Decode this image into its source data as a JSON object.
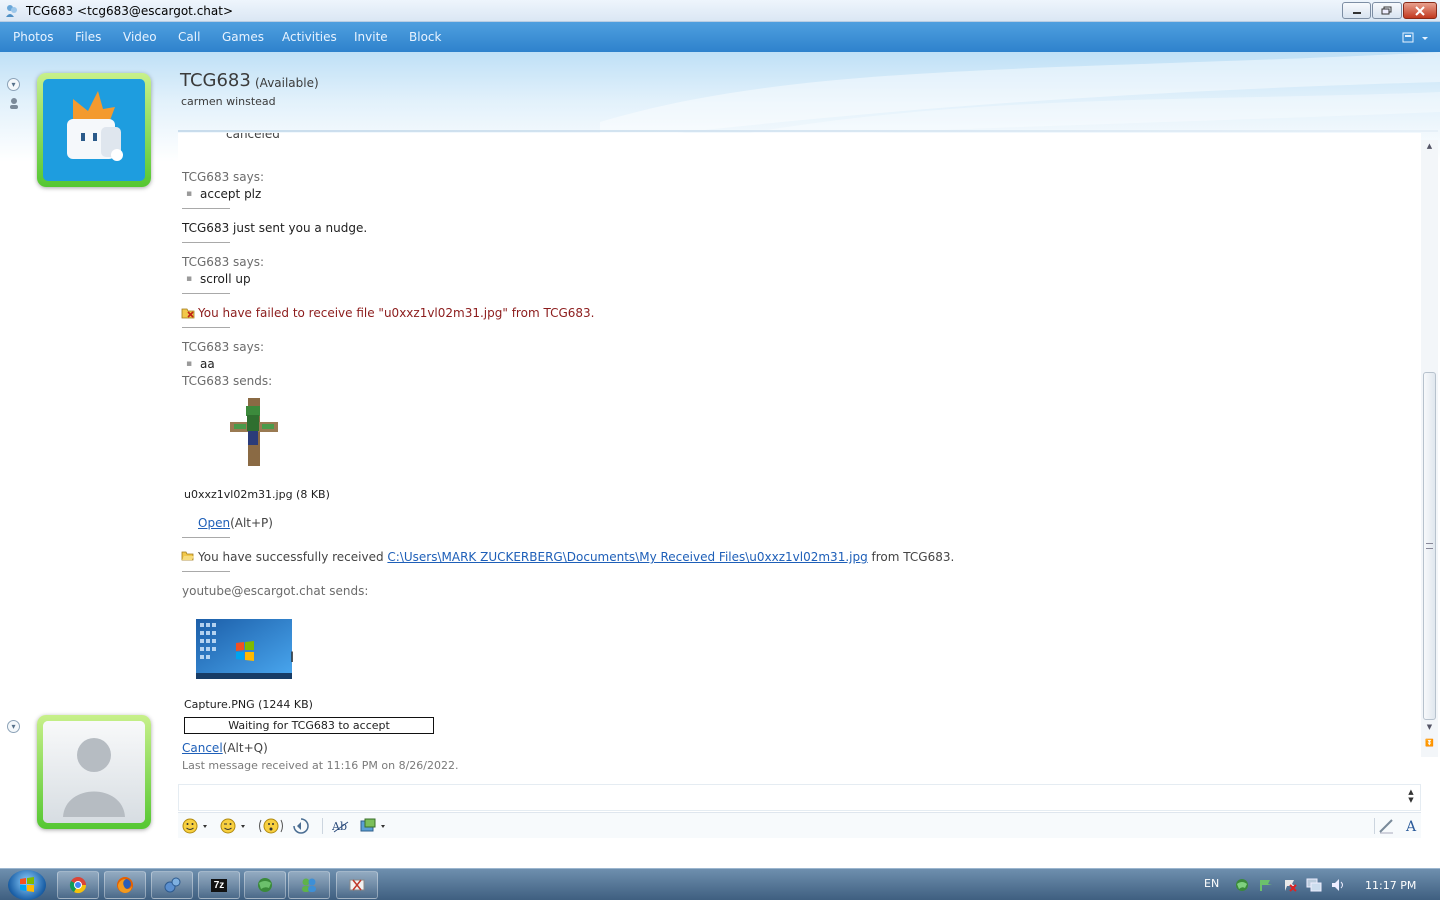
{
  "window": {
    "title": "TCG683 <tcg683@escargot.chat>"
  },
  "menu": [
    "Photos",
    "Files",
    "Video",
    "Call",
    "Games",
    "Activities",
    "Invite",
    "Block"
  ],
  "contact": {
    "name": "TCG683",
    "status": "(Available)",
    "subtitle": "carmen winstead"
  },
  "conversation": {
    "cut_top": "canceled",
    "m1_header": "TCG683 says:",
    "m1_line": "accept plz",
    "nudge": "TCG683 just sent you a nudge.",
    "m2_header": "TCG683 says:",
    "m2_line": "scroll up",
    "fail": "You have failed to receive file \"u0xxz1vl02m31.jpg\" from TCG683.",
    "m3_header": "TCG683 says:",
    "m3_line": "aa",
    "sends1": "TCG683 sends:",
    "file1_name": "u0xxz1vl02m31.jpg (8 KB)",
    "open_link": "Open",
    "open_shortcut": "(Alt+P)",
    "success_prefix": "You have successfully received ",
    "success_path": "C:\\Users\\MARK ZUCKERBERG\\Documents\\My Received Files\\u0xxz1vl02m31.jpg",
    "success_suffix": " from TCG683.",
    "sends2": "youtube@escargot.chat sends:",
    "file2_name": "Capture.PNG (1244 KB)",
    "waiting": "Waiting for TCG683 to accept",
    "cancel_link": "Cancel",
    "cancel_shortcut": "(Alt+Q)",
    "last_received": "Last message received at 11:16 PM on 8/26/2022."
  },
  "taskbar": {
    "lang": "EN",
    "time": "11:17 PM",
    "zip_label": "7z"
  },
  "colors": {
    "menubar": "#3a8fd6",
    "error_text": "#8c1c1c",
    "link": "#1e5fb8",
    "avatar_frame": "#55c732"
  }
}
